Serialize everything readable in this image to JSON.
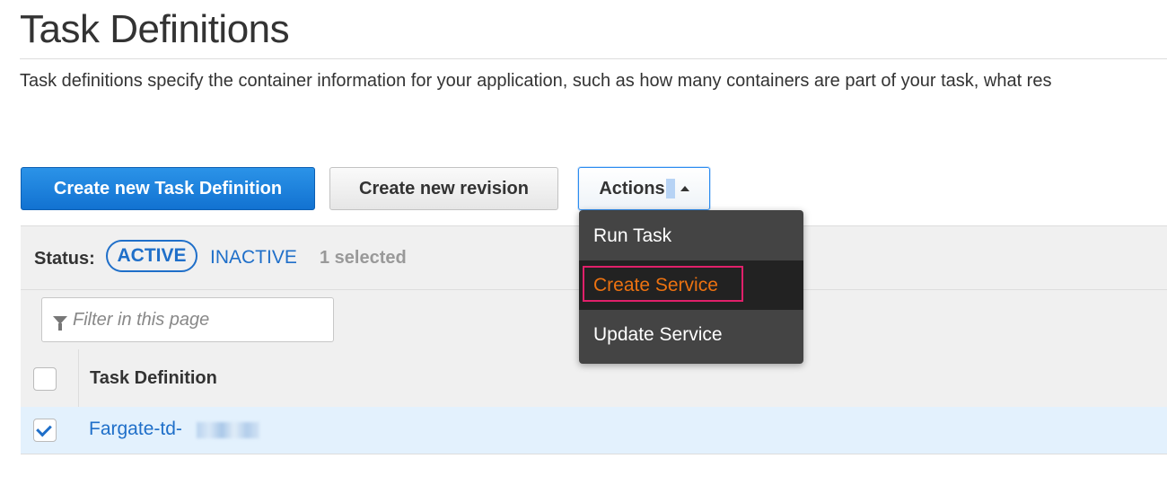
{
  "page": {
    "title": "Task Definitions",
    "description": "Task definitions specify the container information for your application, such as how many containers are part of your task, what res"
  },
  "toolbar": {
    "create_new_label": "Create new Task Definition",
    "create_revision_label": "Create new revision",
    "actions_label": "Actions"
  },
  "status": {
    "label": "Status:",
    "active": "ACTIVE",
    "inactive": "INACTIVE",
    "selected": "1 selected"
  },
  "filter": {
    "placeholder": "Filter in this page"
  },
  "table": {
    "column_header": "Task Definition",
    "rows": [
      {
        "name": "Fargate-td-",
        "checked": true
      }
    ]
  },
  "actions_menu": {
    "items": [
      "Run Task",
      "Create Service",
      "Update Service"
    ],
    "highlighted_index": 1
  },
  "colors": {
    "primary_blue": "#1f6fc9",
    "highlight_orange": "#ec7211",
    "annotation_pink": "#e0206a",
    "menu_bg": "#444444"
  }
}
